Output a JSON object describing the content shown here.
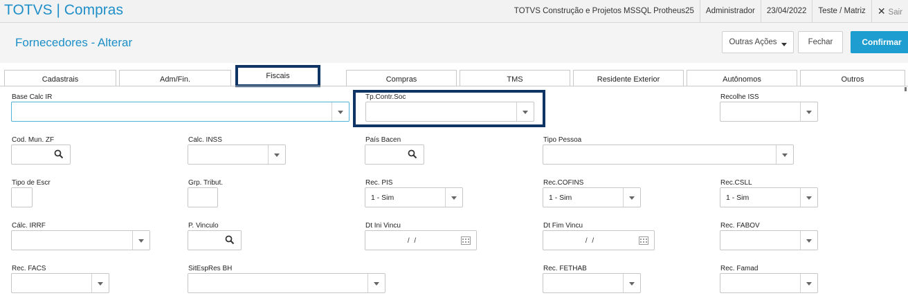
{
  "app": {
    "title": "TOTVS | Compras",
    "environment": "TOTVS Construção e Projetos MSSQL Protheus25",
    "user": "Administrador",
    "date": "23/04/2022",
    "company": "Teste / Matriz",
    "logout_label": "Sair"
  },
  "header": {
    "title": "Fornecedores - Alterar",
    "outras_acoes": "Outras Ações",
    "fechar": "Fechar",
    "confirmar": "Confirmar"
  },
  "tabs": [
    {
      "label": "Cadastrais"
    },
    {
      "label": "Adm/Fin."
    },
    {
      "label": "Fiscais"
    },
    {
      "label": "Compras"
    },
    {
      "label": "TMS"
    },
    {
      "label": "Residente Exterior"
    },
    {
      "label": "Autônomos"
    },
    {
      "label": "Outros"
    }
  ],
  "fields": {
    "base_calc_ir": {
      "label": "Base Calc IR",
      "value": ""
    },
    "tp_contr_soc": {
      "label": "Tp.Contr.Soc",
      "value": ""
    },
    "recolhe_iss": {
      "label": "Recolhe ISS",
      "value": ""
    },
    "cod_mun_zf": {
      "label": "Cod. Mun. ZF",
      "value": ""
    },
    "calc_inss": {
      "label": "Calc. INSS",
      "value": ""
    },
    "pais_bacen": {
      "label": "País Bacen",
      "value": ""
    },
    "tipo_pessoa": {
      "label": "Tipo Pessoa",
      "value": ""
    },
    "tipo_escr": {
      "label": "Tipo de Escr",
      "value": ""
    },
    "grp_tribut": {
      "label": "Grp. Tribut.",
      "value": ""
    },
    "rec_pis": {
      "label": "Rec. PIS",
      "value": "1 - Sim"
    },
    "rec_cofins": {
      "label": "Rec.COFINS",
      "value": "1 - Sim"
    },
    "rec_csll": {
      "label": "Rec.CSLL",
      "value": "1 - Sim"
    },
    "calc_irrf": {
      "label": "Cálc. IRRF",
      "value": ""
    },
    "p_vinculo": {
      "label": "P. Vinculo",
      "value": ""
    },
    "dt_ini_vincu": {
      "label": "Dt Ini Vincu",
      "value": "/ /"
    },
    "dt_fim_vincu": {
      "label": "Dt Fim Vincu",
      "value": "/ /"
    },
    "rec_fabov": {
      "label": "Rec. FABOV",
      "value": ""
    },
    "rec_facs": {
      "label": "Rec. FACS",
      "value": ""
    },
    "sitespres_bh": {
      "label": "SitEspRes BH",
      "value": ""
    },
    "rec_fethab": {
      "label": "Rec. FETHAB",
      "value": ""
    },
    "rec_famad": {
      "label": "Rec. Famad",
      "value": ""
    }
  },
  "colors": {
    "brand": "#1f8fc9",
    "primary_button": "#1e9dd0",
    "highlight": "#0f3565"
  },
  "icons": [
    "search-icon",
    "calendar-icon",
    "chevron-down-icon",
    "close-icon"
  ]
}
